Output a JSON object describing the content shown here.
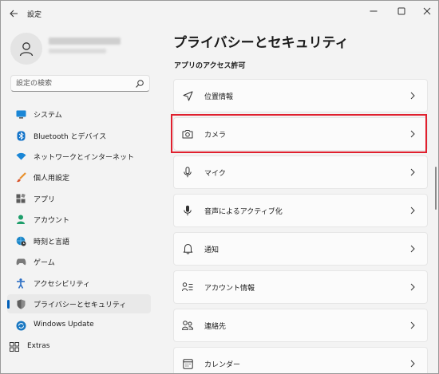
{
  "window": {
    "title": "設定",
    "controls": [
      "minimize",
      "maximize",
      "close"
    ]
  },
  "profile": {
    "name": "",
    "email": ""
  },
  "search": {
    "placeholder": "設定の検索"
  },
  "sidebar": {
    "items": [
      {
        "label": "システム",
        "icon": "system-icon",
        "color": "#0078d4"
      },
      {
        "label": "Bluetooth とデバイス",
        "icon": "bluetooth-icon",
        "color": "#0078d4"
      },
      {
        "label": "ネットワークとインターネット",
        "icon": "wifi-icon",
        "color": "#0063b1"
      },
      {
        "label": "個人用設定",
        "icon": "brush-icon",
        "color": "#e8912d"
      },
      {
        "label": "アプリ",
        "icon": "apps-icon",
        "color": "#5b5b5b"
      },
      {
        "label": "アカウント",
        "icon": "account-icon",
        "color": "#1e9e6b"
      },
      {
        "label": "時刻と言語",
        "icon": "globe-clock-icon",
        "color": "#1a86c8"
      },
      {
        "label": "ゲーム",
        "icon": "gamepad-icon",
        "color": "#7a7a7a"
      },
      {
        "label": "アクセシビリティ",
        "icon": "accessibility-icon",
        "color": "#2d6fc4"
      },
      {
        "label": "プライバシーとセキュリティ",
        "icon": "shield-icon",
        "color": "#6f6f6f",
        "selected": true
      },
      {
        "label": "Windows Update",
        "icon": "windows-update-icon",
        "color": "#1a78c2"
      },
      {
        "label": "Extras",
        "icon": "extras-icon",
        "color": "#333333"
      }
    ]
  },
  "main": {
    "title": "プライバシーとセキュリティ",
    "section": "アプリのアクセス許可",
    "rows": [
      {
        "label": "位置情報",
        "icon": "location-icon"
      },
      {
        "label": "カメラ",
        "icon": "camera-icon",
        "highlighted": true
      },
      {
        "label": "マイク",
        "icon": "microphone-icon"
      },
      {
        "label": "音声によるアクティブ化",
        "icon": "voice-activation-icon"
      },
      {
        "label": "通知",
        "icon": "bell-icon"
      },
      {
        "label": "アカウント情報",
        "icon": "account-info-icon"
      },
      {
        "label": "連絡先",
        "icon": "contacts-icon"
      },
      {
        "label": "カレンダー",
        "icon": "calendar-icon"
      }
    ]
  },
  "colors": {
    "accent": "#005fb8",
    "highlight": "#e0202e",
    "background": "#f3f3f3",
    "card": "#fbfbfb"
  }
}
